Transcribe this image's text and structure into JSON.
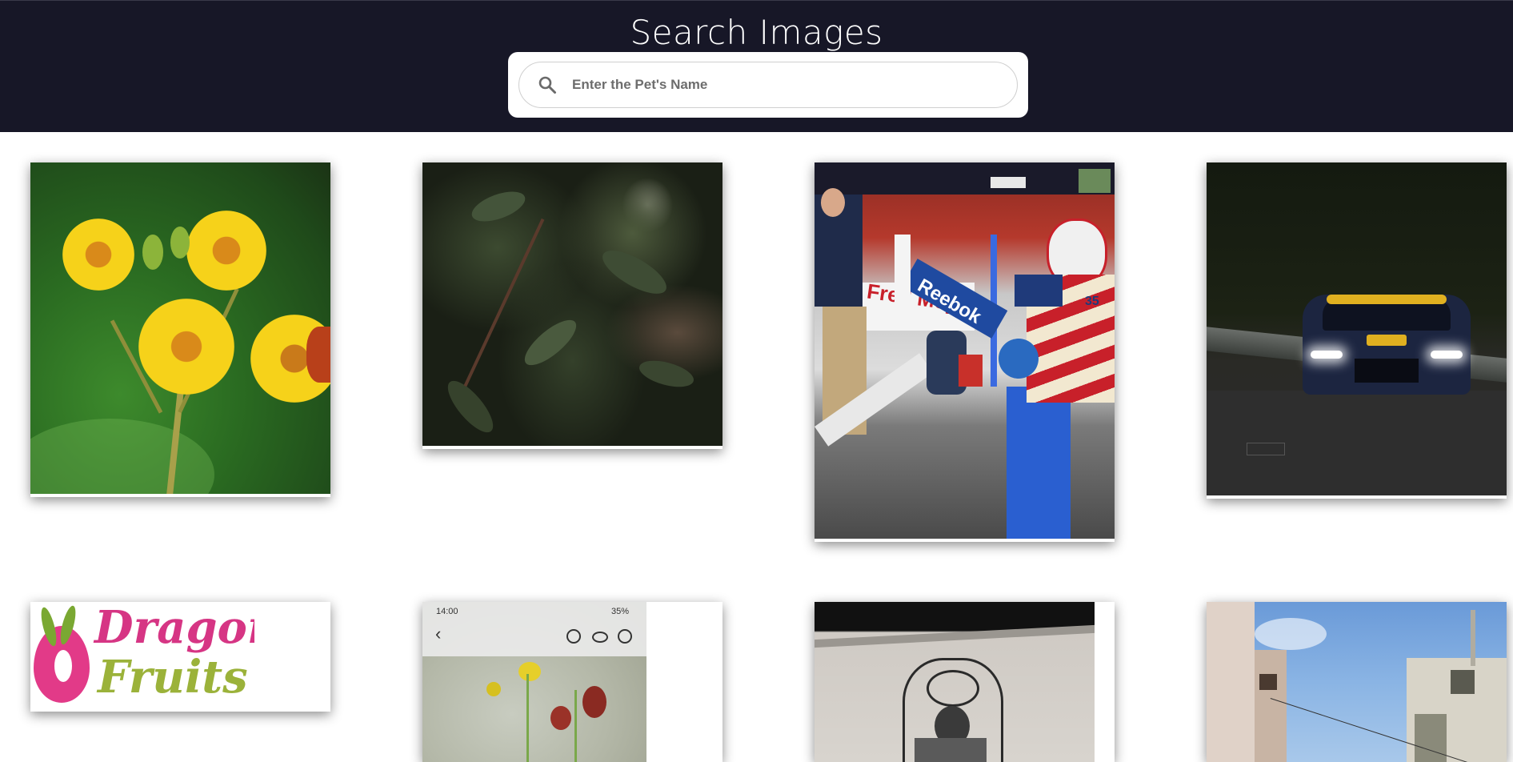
{
  "header": {
    "title": "Search Images"
  },
  "search": {
    "placeholder": "Enter the Pet's Name",
    "value": ""
  },
  "gallery": {
    "images": [
      {
        "subject": "yellow flowers with butterfly"
      },
      {
        "subject": "dark green leaves"
      },
      {
        "subject": "hockey rink goalie on bench"
      },
      {
        "subject": "race car at night"
      },
      {
        "subject": "Dragon Fruits logo",
        "logo_line1": "Dragon",
        "logo_line2": "Fruits"
      },
      {
        "subject": "phone screenshot of flowers",
        "status_time": "14:00",
        "status_battery": "35%"
      },
      {
        "subject": "ink drawing on wall"
      },
      {
        "subject": "old buildings and sky"
      }
    ],
    "sign_text": "Fred Meyer",
    "jersey_text": "Reebok",
    "jersey_number": "35"
  },
  "colors": {
    "header_bg": "#171727",
    "page_bg": "#ffffff",
    "logo_pink": "#d63584",
    "logo_green": "#9bb23a"
  }
}
